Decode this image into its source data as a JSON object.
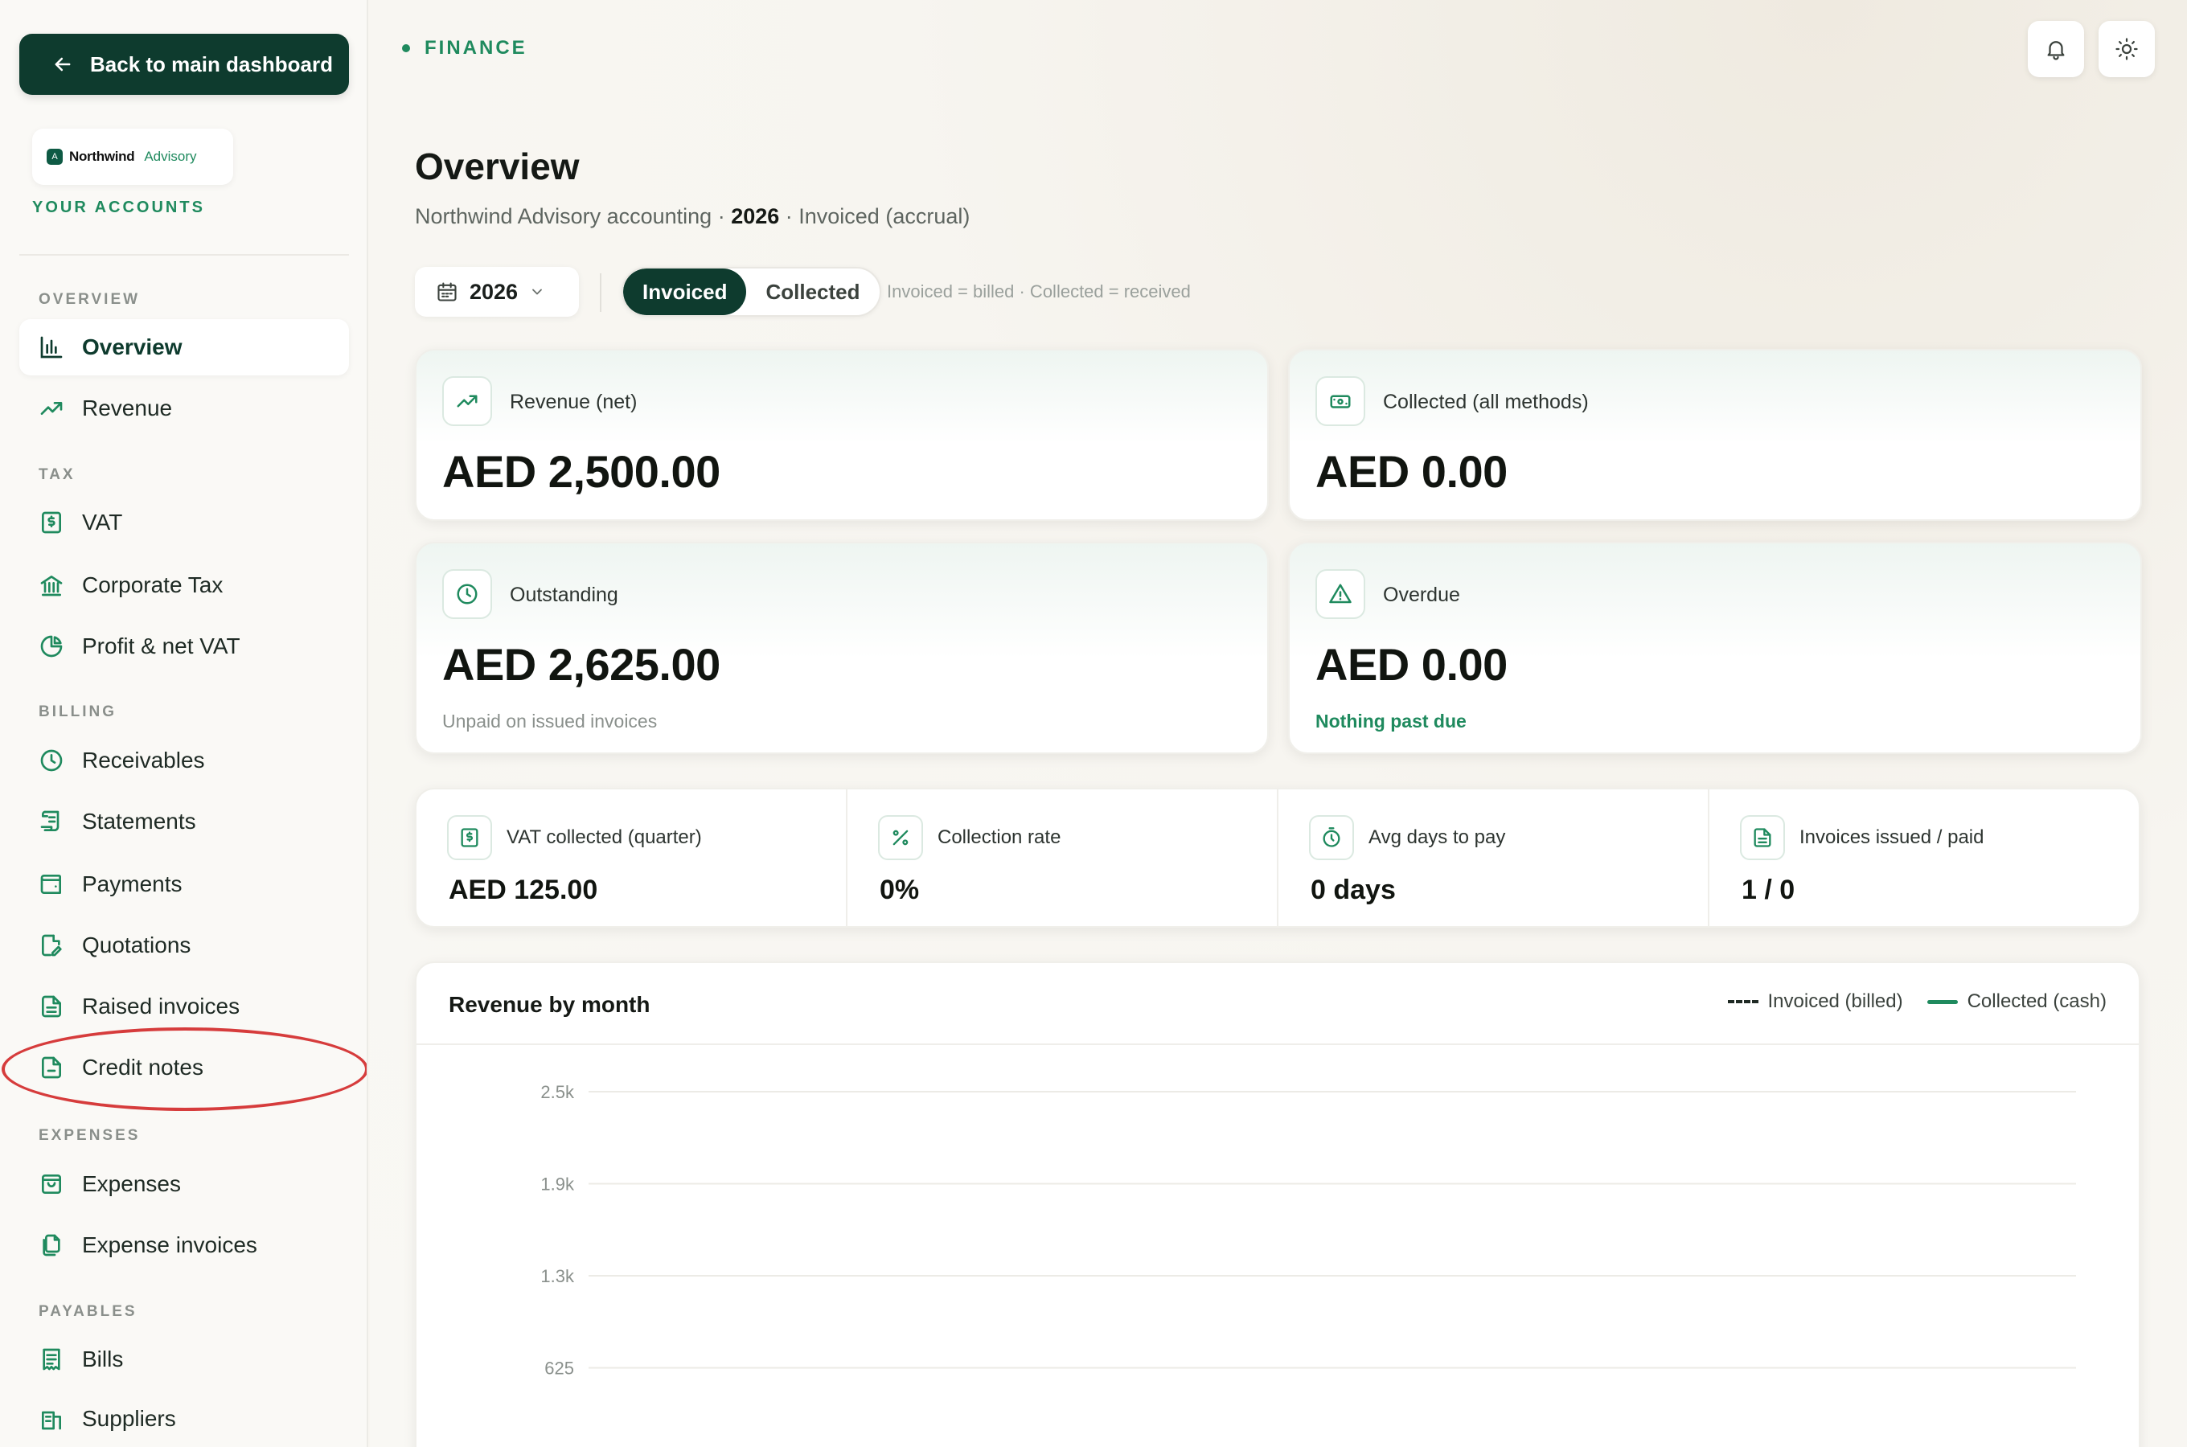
{
  "sidebar": {
    "back_label": "Back to main dashboard",
    "brand": {
      "name": "Northwind",
      "sub": "Advisory",
      "mark": "A"
    },
    "your_accounts": "YOUR ACCOUNTS",
    "sections": {
      "overview": "OVERVIEW",
      "tax": "TAX",
      "billing": "BILLING",
      "expenses": "EXPENSES",
      "payables": "PAYABLES"
    },
    "items": {
      "overview": "Overview",
      "revenue": "Revenue",
      "vat": "VAT",
      "corporate_tax": "Corporate Tax",
      "profit_net_vat": "Profit & net VAT",
      "receivables": "Receivables",
      "statements": "Statements",
      "payments": "Payments",
      "quotations": "Quotations",
      "raised_invoices": "Raised invoices",
      "credit_notes": "Credit notes",
      "expenses": "Expenses",
      "expense_invoices": "Expense invoices",
      "bills": "Bills",
      "suppliers": "Suppliers"
    }
  },
  "header": {
    "breadcrumb": "FINANCE",
    "title": "Overview",
    "subtitle_prefix": "Northwind Advisory accounting · ",
    "subtitle_year": "2026",
    "subtitle_suffix": " · Invoiced (accrual)"
  },
  "controls": {
    "year": "2026",
    "mode_invoiced": "Invoiced",
    "mode_collected": "Collected",
    "hint": "Invoiced = billed · Collected = received"
  },
  "cards": {
    "revenue": {
      "label": "Revenue (net)",
      "value": "AED 2,500.00"
    },
    "collected": {
      "label": "Collected (all methods)",
      "value": "AED 0.00"
    },
    "outstanding": {
      "label": "Outstanding",
      "value": "AED 2,625.00",
      "note": "Unpaid on issued invoices"
    },
    "overdue": {
      "label": "Overdue",
      "value": "AED 0.00",
      "note": "Nothing past due"
    }
  },
  "stats": {
    "vat": {
      "label": "VAT collected (quarter)",
      "value": "AED 125.00"
    },
    "collection_rate": {
      "label": "Collection rate",
      "value": "0%"
    },
    "avg_days": {
      "label": "Avg days to pay",
      "value": "0 days"
    },
    "invoices": {
      "label": "Invoices issued / paid",
      "value": "1 / 0"
    }
  },
  "chart": {
    "title": "Revenue by month",
    "legend_invoiced": "Invoiced (billed)",
    "legend_collected": "Collected (cash)"
  },
  "chart_data": {
    "type": "line",
    "title": "Revenue by month",
    "xlabel": "",
    "ylabel": "",
    "y_ticks": [
      "2.5k",
      "1.9k",
      "1.3k",
      "625"
    ],
    "y_tick_values": [
      2500,
      1875,
      1250,
      625
    ],
    "series": [
      {
        "name": "Invoiced (billed)",
        "style": "dashed",
        "color": "#1f2a24",
        "values": []
      },
      {
        "name": "Collected (cash)",
        "style": "solid",
        "color": "#1f8a5e",
        "values": []
      }
    ],
    "grid": true,
    "legend_position": "top-right"
  },
  "colors": {
    "brand_dark": "#0e3b2e",
    "accent_green": "#1f8a5e",
    "highlight_red": "#d63c3c"
  }
}
